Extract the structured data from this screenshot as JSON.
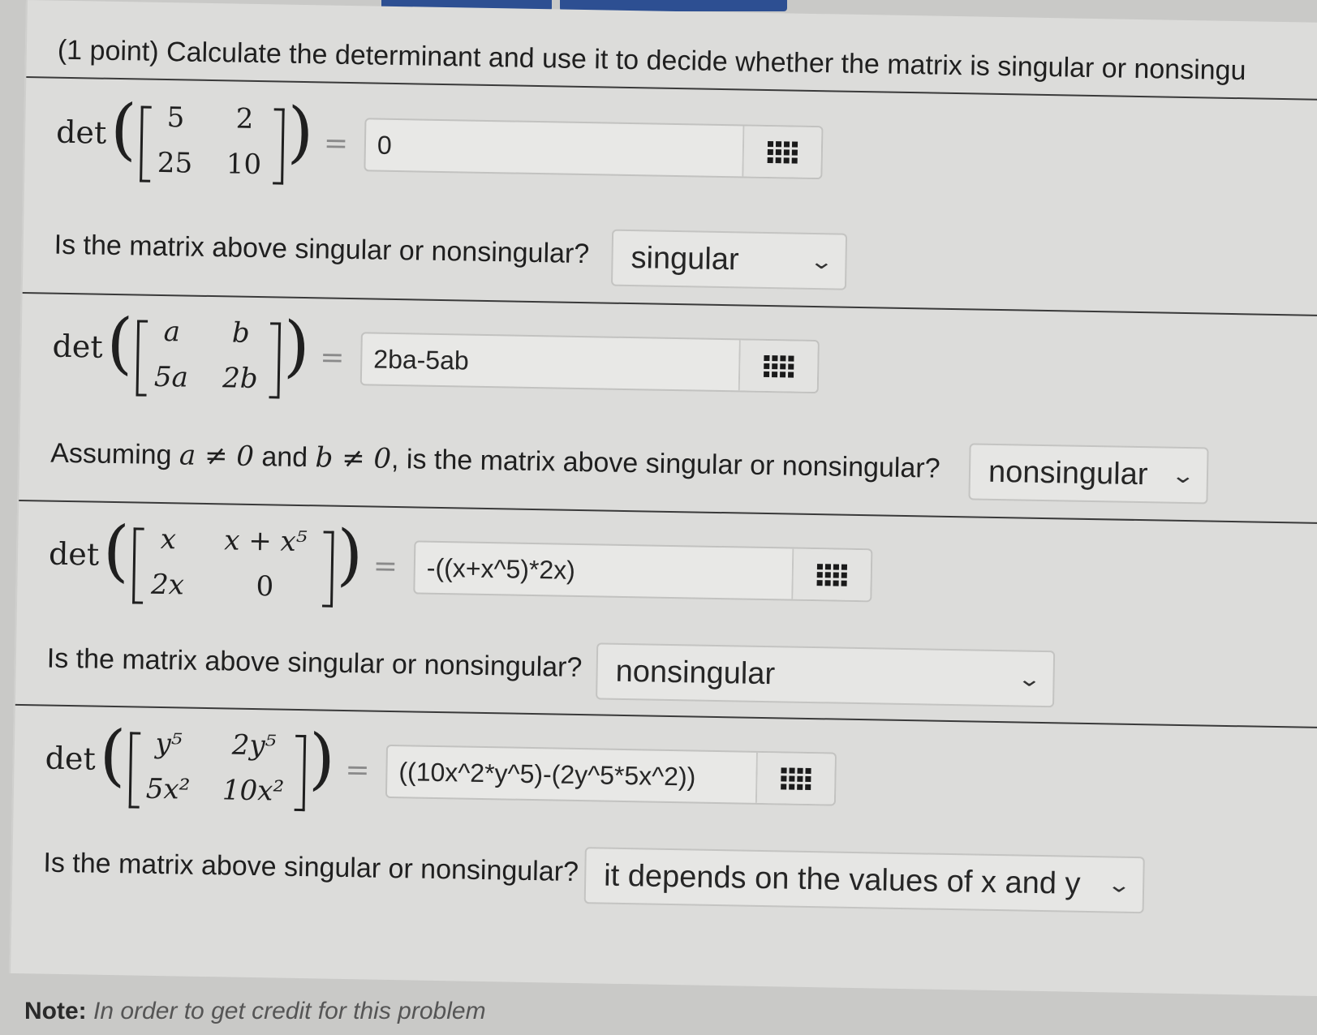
{
  "header": {
    "title": "(1 point) Calculate the determinant and use it to decide whether the matrix is singular or nonsingu"
  },
  "problems": [
    {
      "det_label": "det",
      "matrix": [
        [
          "5",
          "2"
        ],
        [
          "25",
          "10"
        ]
      ],
      "answer_value": "0",
      "question": "Is the matrix above singular or nonsingular?",
      "selected": "singular"
    },
    {
      "det_label": "det",
      "matrix": [
        [
          "a",
          "b"
        ],
        [
          "5a",
          "2b"
        ]
      ],
      "answer_value": "2ba-5ab",
      "question_parts": [
        "Assuming ",
        "a ≠ 0",
        " and ",
        "b ≠ 0",
        ", is the matrix above singular or nonsingular?"
      ],
      "selected": "nonsingular"
    },
    {
      "det_label": "det",
      "matrix": [
        [
          "x",
          "x + x⁵"
        ],
        [
          "2x",
          "0"
        ]
      ],
      "answer_value": "-((x+x^5)*2x)",
      "question": "Is the matrix above singular or nonsingular?",
      "selected": "nonsingular"
    },
    {
      "det_label": "det",
      "matrix": [
        [
          "y⁵",
          "2y⁵"
        ],
        [
          "5x²",
          "10x²"
        ]
      ],
      "answer_value": "((10x^2*y^5)-(2y^5*5x^2))",
      "question": "Is the matrix above singular or nonsingular?",
      "selected": "it depends on the values of x and y"
    }
  ],
  "equals_sign": "=",
  "icons": {
    "answer_tool": "grid-icon",
    "dropdown": "chevron-down-icon"
  },
  "footer": {
    "note_label": "Note:",
    "note_text": "In order to get credit for this problem"
  },
  "colors": {
    "accent": "#2d4f92",
    "background": "#dcdcda"
  }
}
